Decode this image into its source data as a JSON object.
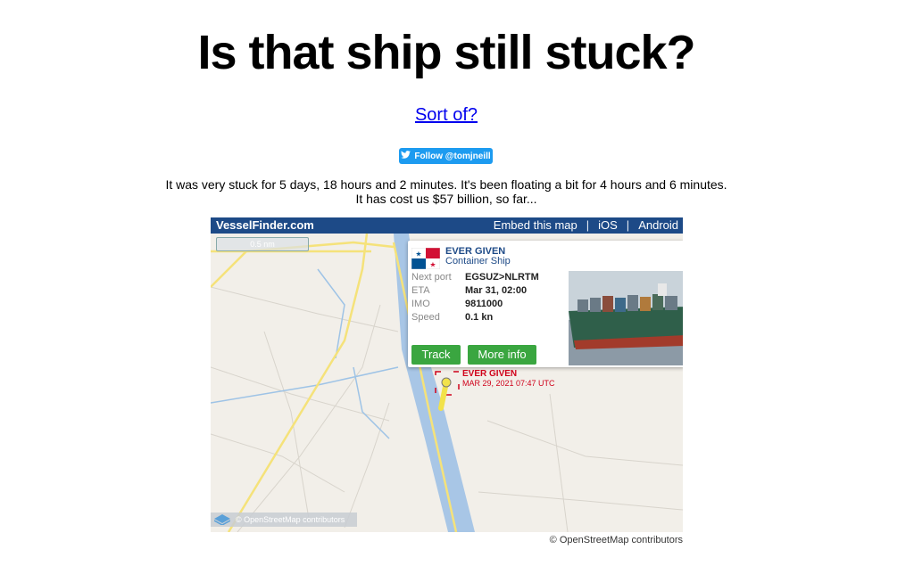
{
  "header": {
    "title": "Is that ship still stuck?",
    "link": "Sort of?",
    "follow_label": "Follow @tomjneill",
    "status_line1": "It was very stuck for 5 days, 18 hours and 2 minutes. It's been floating a bit for 4 hours and 6 minutes.",
    "status_line2": "It has cost us $57 billion, so far..."
  },
  "map": {
    "brand": "VesselFinder.com",
    "links": [
      "Embed this map",
      "iOS",
      "Android"
    ],
    "separator": "|",
    "scale": "0.5 nm",
    "osm": "© OpenStreetMap contributors",
    "popup": {
      "name": "EVER GIVEN",
      "type": "Container Ship",
      "rows": [
        {
          "k": "Next port",
          "v": "EGSUZ>NLRTM"
        },
        {
          "k": "ETA",
          "v": "Mar 31, 02:00"
        },
        {
          "k": "IMO",
          "v": "9811000"
        },
        {
          "k": "Speed",
          "v": "0.1 kn"
        }
      ],
      "track": "Track",
      "more": "More info"
    },
    "vessel_label": {
      "name": "EVER GIVEN",
      "time": "MAR 29, 2021 07:47 UTC"
    }
  },
  "footer": {
    "credit": "© OpenStreetMap contributors"
  },
  "colors": {
    "bar": "#1d4a87",
    "button": "#3aa640",
    "water": "#a8c6e6",
    "road": "#f5e27a",
    "vessel": "#d0021b"
  }
}
